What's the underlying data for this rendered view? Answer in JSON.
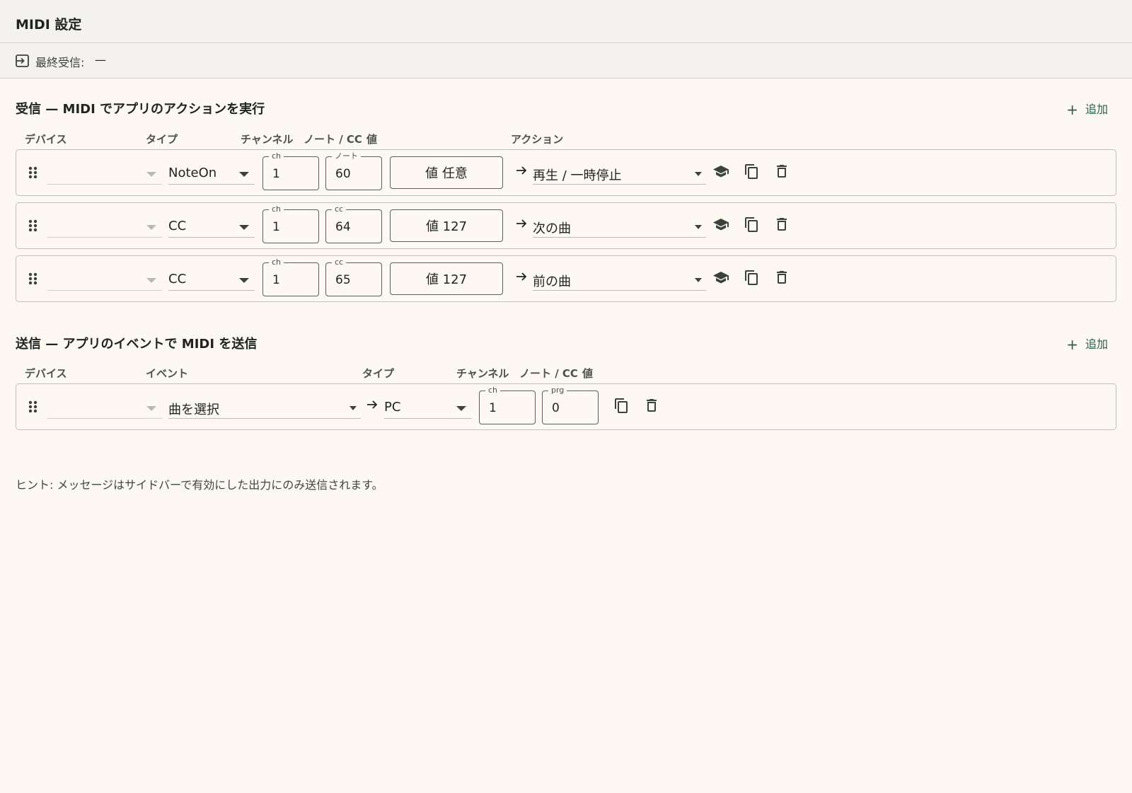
{
  "header": {
    "title": "MIDI 設定"
  },
  "status": {
    "label": "最終受信:",
    "value": "—"
  },
  "receive": {
    "title": "受信 — MIDI でアプリのアクションを実行",
    "add_label": "追加",
    "columns": {
      "device": "デバイス",
      "type": "タイプ",
      "channel": "チャンネル",
      "note_cc": "ノート / CC",
      "value": "値",
      "action": "アクション"
    },
    "rows": [
      {
        "device": "",
        "type": "NoteOn",
        "ch_label": "ch",
        "ch": "1",
        "num_label": "ノート",
        "num": "60",
        "value_btn": "値 任意",
        "action": "再生 / 一時停止"
      },
      {
        "device": "",
        "type": "CC",
        "ch_label": "ch",
        "ch": "1",
        "num_label": "cc",
        "num": "64",
        "value_btn": "値 127",
        "action": "次の曲"
      },
      {
        "device": "",
        "type": "CC",
        "ch_label": "ch",
        "ch": "1",
        "num_label": "cc",
        "num": "65",
        "value_btn": "値 127",
        "action": "前の曲"
      }
    ]
  },
  "send": {
    "title": "送信 — アプリのイベントで MIDI を送信",
    "add_label": "追加",
    "columns": {
      "device": "デバイス",
      "event": "イベント",
      "type": "タイプ",
      "channel": "チャンネル",
      "note_cc": "ノート / CC",
      "value": "値"
    },
    "rows": [
      {
        "device": "",
        "event": "曲を選択",
        "type": "PC",
        "ch_label": "ch",
        "ch": "1",
        "num_label": "prg",
        "num": "0"
      }
    ]
  },
  "hint": "ヒント: メッセージはサイドバーで有効にした出力にのみ送信されます。",
  "colors": {
    "background": "#fdf8f1",
    "header": "#f3f2ee",
    "accent": "#2c5e4a",
    "border": "#bcc1bb"
  },
  "icons": [
    "input-icon",
    "drag-handle-icon",
    "arrow-right-icon",
    "learn-cap-icon",
    "copy-icon",
    "trash-icon",
    "plus-icon"
  ]
}
